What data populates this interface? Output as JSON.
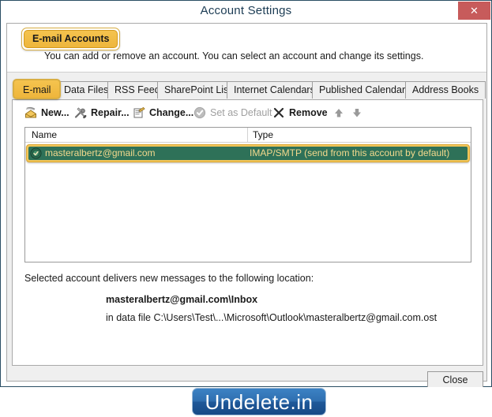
{
  "window": {
    "title": "Account Settings",
    "close_icon": "close-icon",
    "close_glyph": "✕"
  },
  "header": {
    "badge_label": "E-mail Accounts",
    "description": "You can add or remove an account. You can select an account and change its settings."
  },
  "tabs": [
    {
      "label": "E-mail",
      "active": true
    },
    {
      "label": "Data Files",
      "active": false
    },
    {
      "label": "RSS Feeds",
      "active": false
    },
    {
      "label": "SharePoint Lists",
      "active": false
    },
    {
      "label": "Internet Calendars",
      "active": false
    },
    {
      "label": "Published Calendars",
      "active": false
    },
    {
      "label": "Address Books",
      "active": false
    }
  ],
  "toolbar": [
    {
      "label": "New...",
      "icon": "new-mail-icon",
      "disabled": false
    },
    {
      "label": "Repair...",
      "icon": "repair-tools-icon",
      "disabled": false
    },
    {
      "label": "Change...",
      "icon": "change-properties-icon",
      "disabled": false
    },
    {
      "label": "Set as Default",
      "icon": "set-as-default-check-icon",
      "disabled": true
    },
    {
      "label": "Remove",
      "icon": "remove-x-icon",
      "disabled": false
    },
    {
      "label": "",
      "icon": "move-up-arrow-icon",
      "disabled": true
    },
    {
      "label": "",
      "icon": "move-down-arrow-icon",
      "disabled": true
    }
  ],
  "account_list": {
    "columns": [
      "Name",
      "Type"
    ],
    "rows": [
      {
        "name": "masteralbertz@gmail.com",
        "type": "IMAP/SMTP (send from this account by default)",
        "icon": "default-account-icon",
        "selected": true
      }
    ]
  },
  "delivery": {
    "label": "Selected account delivers new messages to the following location:",
    "location": "masteralbertz@gmail.com\\Inbox",
    "data_file": "in data file C:\\Users\\Test\\...\\Microsoft\\Outlook\\masteralbertz@gmail.com.ost"
  },
  "footer": {
    "close_label": "Close"
  },
  "watermark": {
    "text": "Undelete.in"
  },
  "colors": {
    "accent_gold": "#eeb63c",
    "selection_green": "#2e7158",
    "close_red": "#c75b5b",
    "title_text": "#1c3c54",
    "watermark_blue": "#2f6fb0"
  }
}
